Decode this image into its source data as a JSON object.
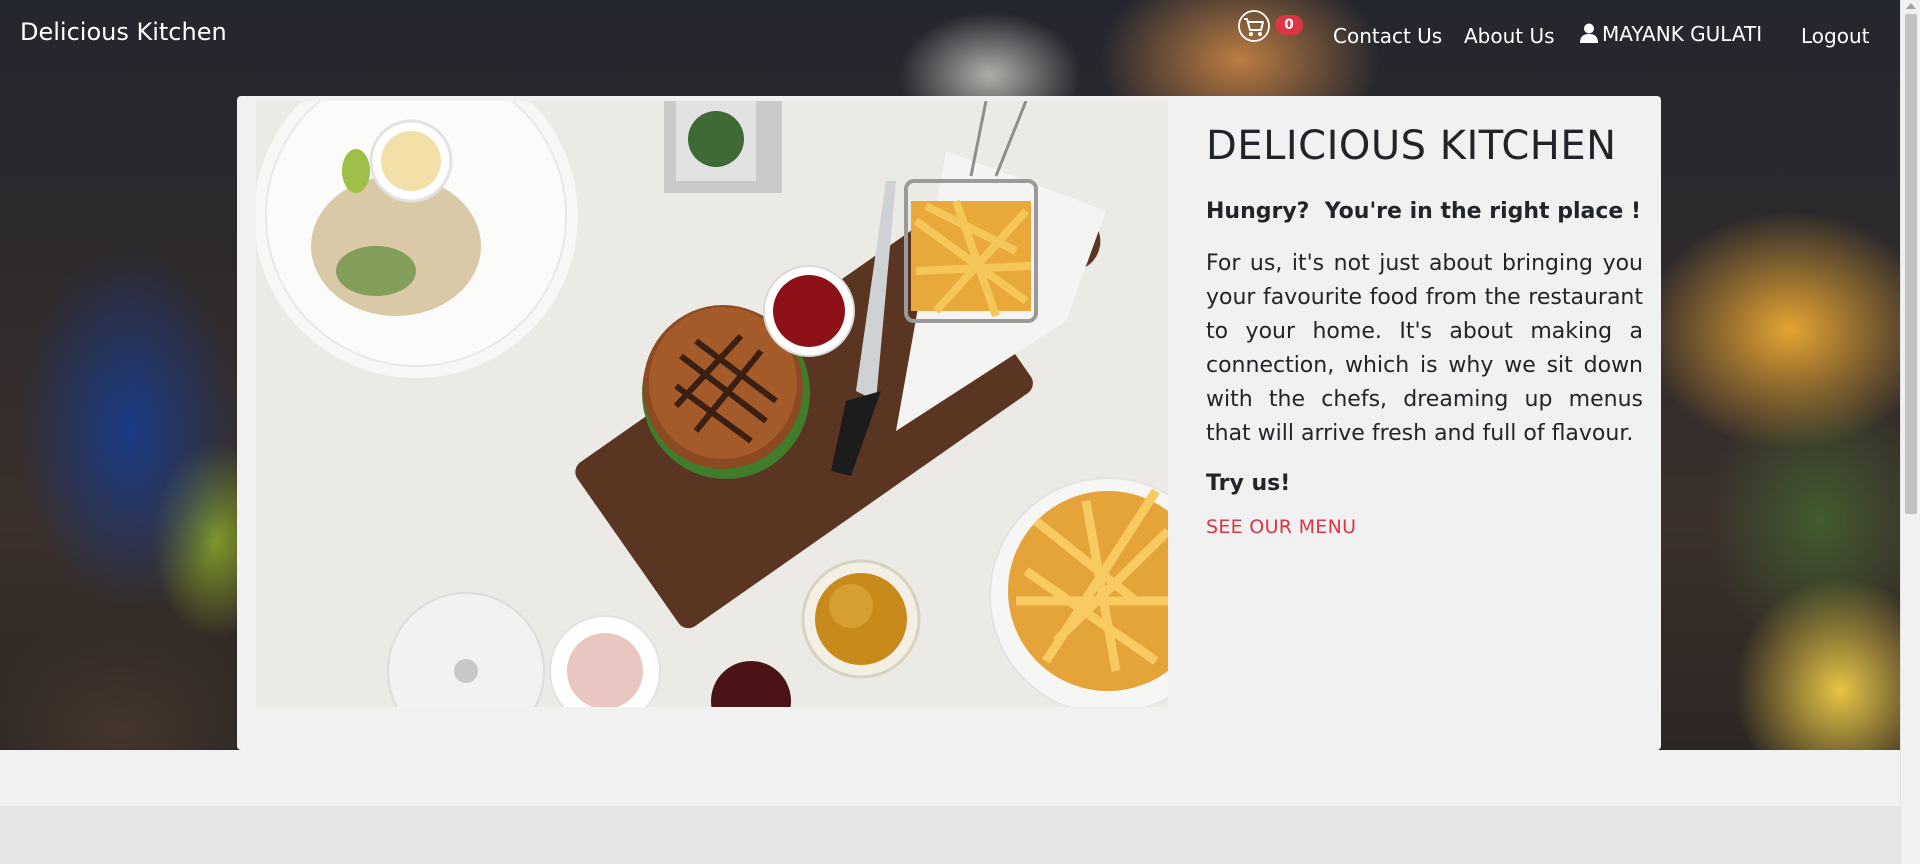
{
  "navbar": {
    "brand": "Delicious Kitchen",
    "cart_count": "0",
    "contact_label": "Contact Us",
    "about_label": "About Us",
    "user_name": "MAYANK GULATI",
    "logout_label": "Logout",
    "icons": [
      "shopping-cart-icon",
      "user-icon"
    ]
  },
  "hero": {
    "title": "DELICIOUS KITCHEN",
    "tagline": "Hungry?  You're in the right place !",
    "description": "For us, it's not just about bringing you your favourite food from the restaurant to your home. It's about making a connection, which is why we sit down with the chefs, dreaming up menus that will arrive fresh and full of flavour.",
    "call_to_action": "Try us!",
    "menu_link": "SEE OUR MENU"
  },
  "colors": {
    "accent": "#dc3545",
    "badge": "#dc3545",
    "card_background": "#f1f1f1",
    "navbar_text": "#ffffff"
  }
}
